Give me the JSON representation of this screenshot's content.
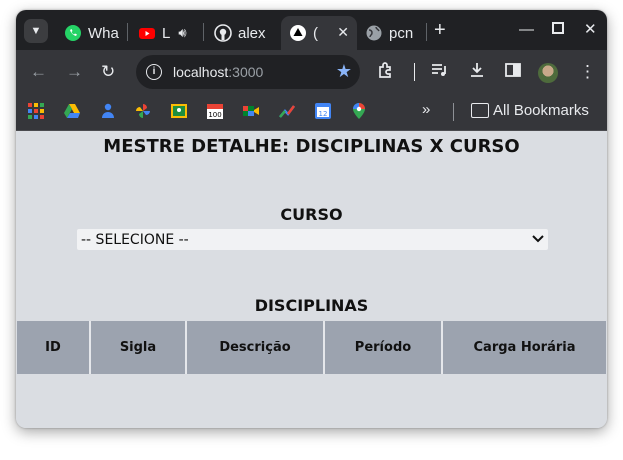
{
  "browser": {
    "tabs": [
      {
        "label": "Wha",
        "icon": "whatsapp-icon"
      },
      {
        "label": "L",
        "icon": "youtube-icon"
      },
      {
        "label": "alex",
        "icon": "github-icon"
      },
      {
        "label": "(",
        "icon": "app-icon",
        "active": true
      },
      {
        "label": "pcn",
        "icon": "globe-icon"
      }
    ],
    "address": {
      "host": "localhost",
      "port": ":3000"
    },
    "bookmarks_all": "All Bookmarks",
    "more_symbol": "»"
  },
  "page": {
    "title": "MESTRE DETALHE: DISCIPLINAS X CURSO",
    "curso_label": "CURSO",
    "curso_select_value": "-- SELECIONE --",
    "disciplinas_label": "DISCIPLINAS",
    "table_headers": [
      "ID",
      "Sigla",
      "Descrição",
      "Período",
      "Carga Horária"
    ]
  },
  "colors": {
    "page_background": "#dadde2",
    "table_header_background": "#9ca3af",
    "browser_chrome": "#35363a"
  }
}
